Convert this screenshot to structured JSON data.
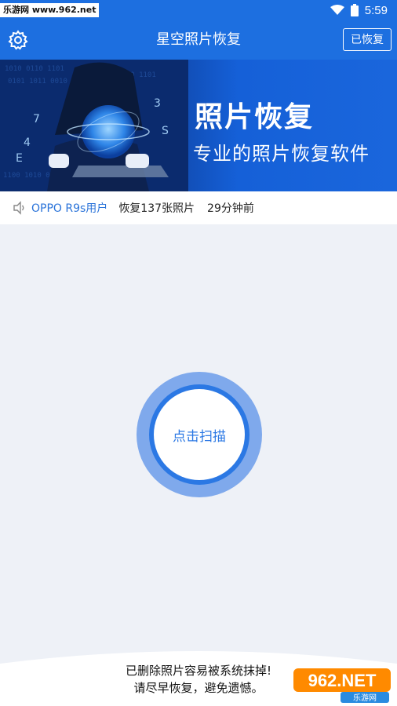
{
  "status_bar": {
    "watermark": "乐游网 www.962.net",
    "time": "5:59"
  },
  "app_bar": {
    "title": "星空照片恢复",
    "recovered_button": "已恢复",
    "settings_icon": "gear-icon"
  },
  "banner": {
    "title": "照片恢复",
    "subtitle": "专业的照片恢复软件"
  },
  "notice": {
    "icon": "speaker-icon",
    "user": "OPPO R9s用户",
    "count": "恢复137张照片",
    "time_ago": "29分钟前"
  },
  "scan": {
    "label": "点击扫描"
  },
  "footer": {
    "line1": "已删除照片容易被系统抹掉!",
    "line2": "请尽早恢复，避免遗憾。",
    "logo_text": "962.NET",
    "logo_sub": "乐游网"
  },
  "colors": {
    "primary": "#1d6fe0",
    "scan_outer": "#7fa9ec",
    "scan_ring": "#2b78e4",
    "user_link": "#2a73d9",
    "background": "#eef1f7"
  }
}
